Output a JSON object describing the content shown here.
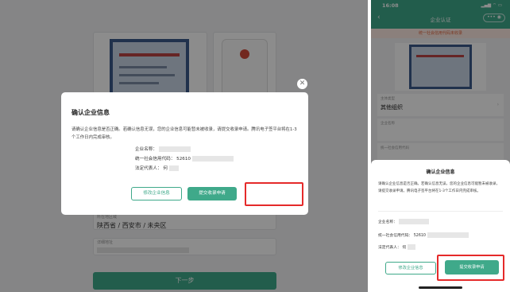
{
  "desktop": {
    "region_field": {
      "label": "所在地区域",
      "value": "陕西省 / 西安市 / 未央区"
    },
    "address_field": {
      "label": "详细地址"
    },
    "next_button": "下一步",
    "close_icon": "close-icon",
    "dialog": {
      "title": "确认企业信息",
      "body": "请确认企业信息是否正确。若确认信息无误，您的企业信息可能暂未被收录，请提交收录申请。腾讯电子签平台将在1-3个工作日内完成审核。",
      "name_label": "企业名称：",
      "code_label": "统一社会信用代码：",
      "code_value": "52610",
      "rep_label": "法定代表人：",
      "rep_value": "何",
      "edit_button": "修改企业信息",
      "submit_button": "提交收录申请"
    }
  },
  "phone": {
    "time": "16:08",
    "status_icons": "▂▄▆ ⌔ ▭",
    "back_icon": "chevron-left-icon",
    "back_glyph": "‹",
    "title": "企业认证",
    "capsule": "••• ◉",
    "banner": "统一社会信用代码未收录",
    "type_field": {
      "label": "主体类型",
      "value": "其他组织"
    },
    "name_field": {
      "label": "企业名称"
    },
    "code_field": {
      "label": "统一社会信用代码"
    },
    "sheet": {
      "title": "确认企业信息",
      "body": "请确认企业信息是否正确。若确认信息无误，您的企业信息可能暂未被收录，请提交收录申请。腾讯电子签平台将在1-3个工作日内完成审核。",
      "name_label": "企业名称：",
      "code_label": "统一社会信用代码：",
      "code_value": "52610",
      "rep_label": "法定代表人：",
      "rep_value": "何",
      "edit_button": "修改企业信息",
      "submit_button": "提交收录申请"
    }
  },
  "colors": {
    "brand": "#3fa98a",
    "highlight": "#e52a2a",
    "banner_text": "#e0683f"
  }
}
